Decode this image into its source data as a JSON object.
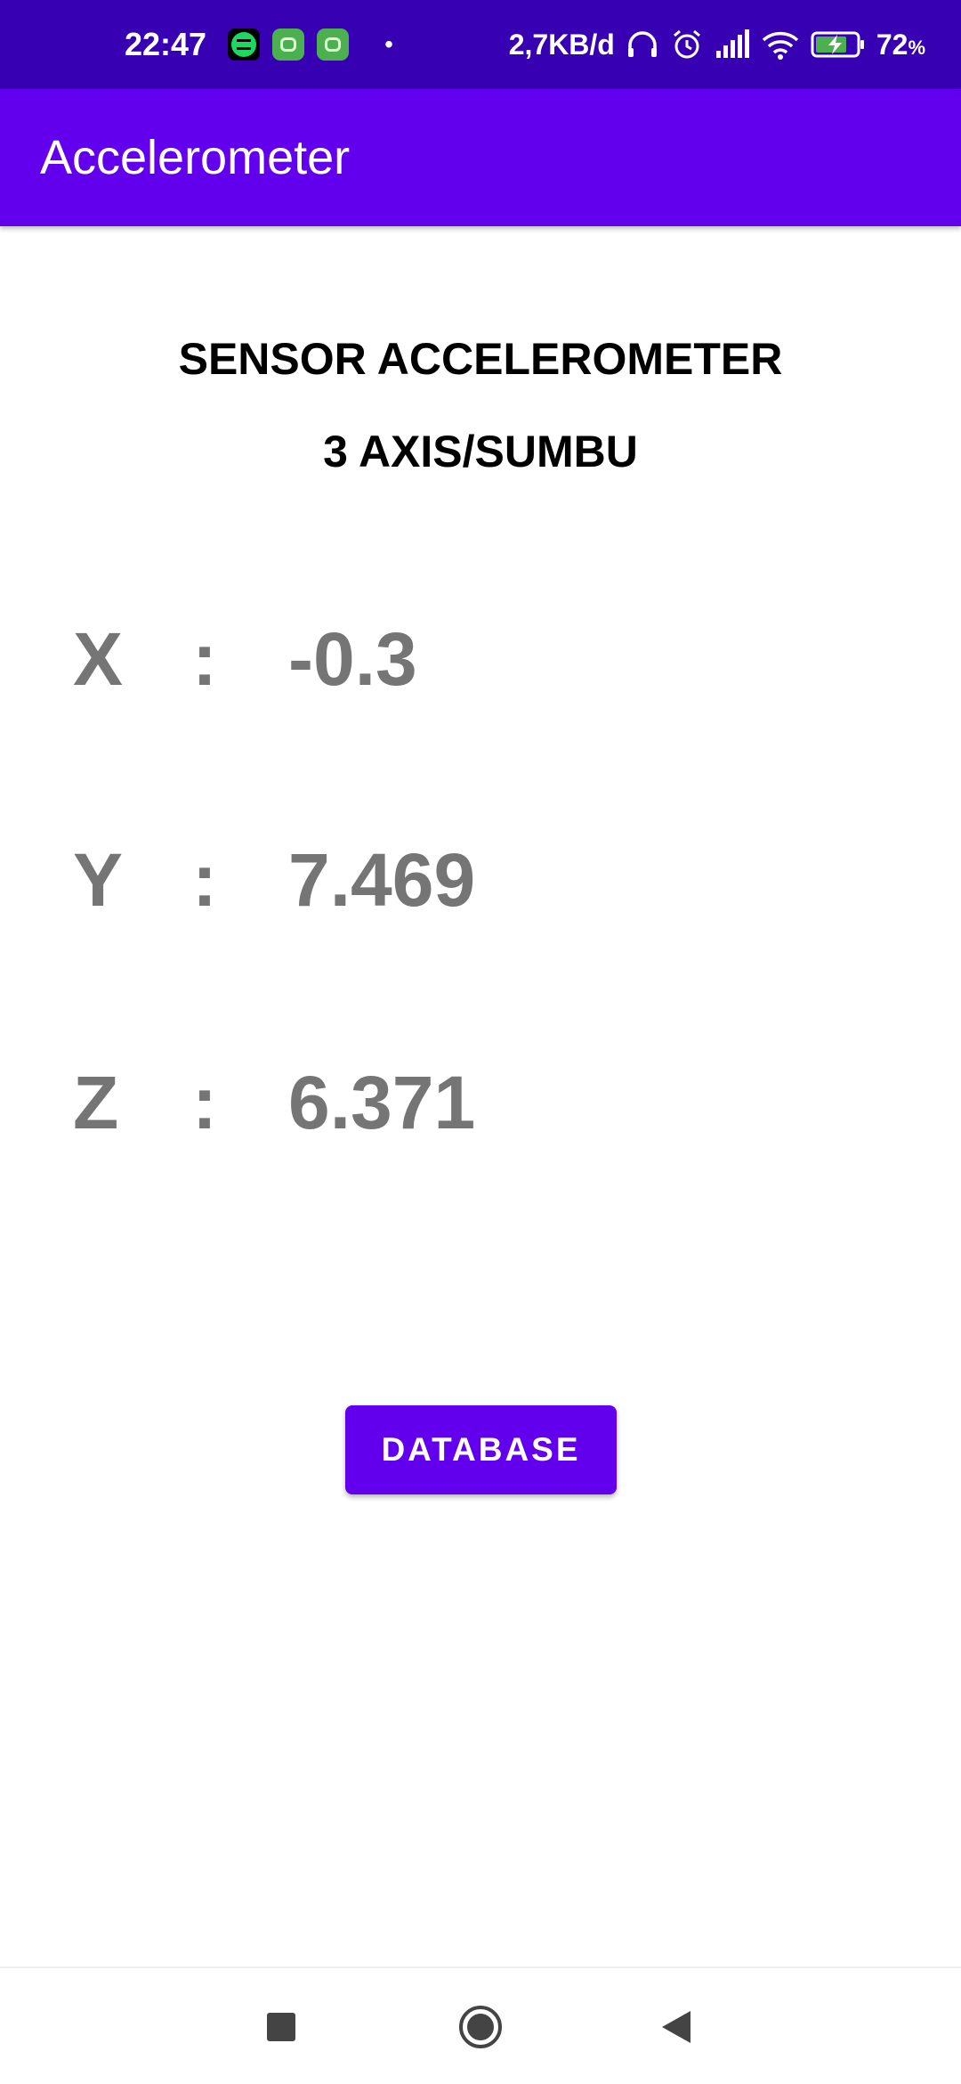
{
  "status_bar": {
    "time": "22:47",
    "dot": "•",
    "net_speed": "2,7KB/d",
    "battery_percent": "72",
    "battery_unit": "%",
    "notification_icons": [
      "spotify-icon",
      "green-app-icon",
      "green-app-icon"
    ],
    "status_icons": [
      "headphones-icon",
      "alarm-icon",
      "signal-icon",
      "wifi-icon",
      "battery-charging-icon"
    ]
  },
  "app_bar": {
    "title": "Accelerometer"
  },
  "content": {
    "heading_line1": "SENSOR ACCELEROMETER",
    "heading_line2": "3 AXIS/SUMBU",
    "axes": [
      {
        "label": "X",
        "separator": ":",
        "value": "-0.3"
      },
      {
        "label": "Y",
        "separator": ":",
        "value": "7.469"
      },
      {
        "label": "Z",
        "separator": ":",
        "value": "6.371"
      }
    ],
    "database_button_label": "DATABASE"
  },
  "colors": {
    "status_bar": "#3700b3",
    "primary": "#6200ee",
    "value_text": "#757575",
    "nav_icons": "#444444"
  },
  "nav_bar": {
    "icons": [
      "recents-icon",
      "home-icon",
      "back-icon"
    ]
  }
}
